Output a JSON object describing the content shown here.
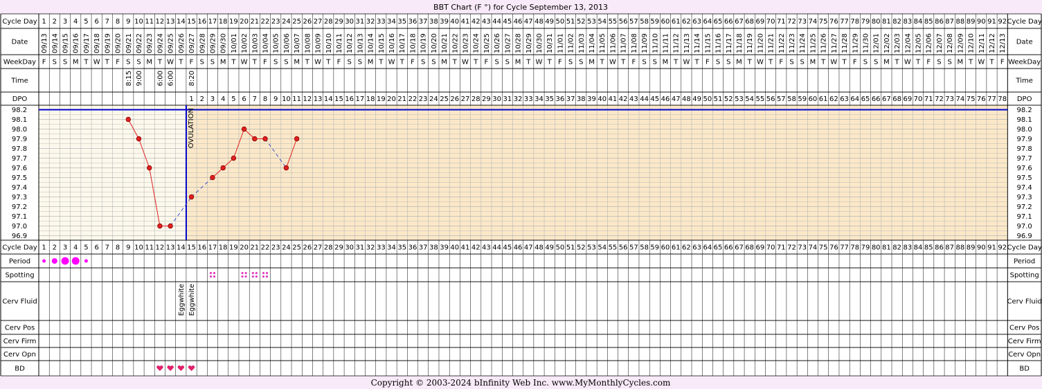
{
  "title": "BBT Chart (F °) for Cycle September 13, 2013",
  "copyright": "Copyright © 2003-2024 bInfinity Web Inc.     www.MyMonthlyCycles.com",
  "row_labels": {
    "cycle_day": "Cycle Day",
    "date": "Date",
    "weekday": "WeekDay",
    "time": "Time",
    "dpo": "DPO",
    "period": "Period",
    "spotting": "Spotting",
    "cerv_fluid": "Cerv Fluid",
    "cerv_pos": "Cerv Pos",
    "cerv_firm": "Cerv Firm",
    "cerv_opn": "Cerv Opn",
    "bd": "BD"
  },
  "ovulation_label": "OVULATION",
  "ovulation_day": 14,
  "num_days": 92,
  "start_date": "2013-09-13",
  "weekday_letters": [
    "F",
    "S",
    "S",
    "M",
    "T",
    "W",
    "T"
  ],
  "times": {
    "9": "8:15",
    "10": "9:00",
    "12": "6:00",
    "13": "6:00",
    "15": "8:20"
  },
  "period": {
    "1": "light",
    "2": "medium",
    "3": "heavy",
    "4": "heavy",
    "5": "light"
  },
  "spotting_days": [
    17,
    20,
    21,
    22
  ],
  "cerv_fluid": {
    "14": "Eggwhite",
    "15": "Eggwhite"
  },
  "bd_days": [
    12,
    13,
    14,
    15
  ],
  "colors": {
    "pre_fill": "#fcf9ec",
    "post_fill": "#fbe8c8",
    "grid": "#b7b7b7",
    "cover_line": "#0000cc",
    "ovulation_line": "#0000cc",
    "temp_line": "#e02020",
    "temp_dot": "#e02020",
    "dashed_line": "#3a4ccc",
    "period": "#ff00ff",
    "spotting": "#e040c0",
    "bd": "#e0206a",
    "page_bg": "#f8eaf8"
  },
  "chart_data": {
    "type": "line",
    "title": "BBT Chart (F °) for Cycle September 13, 2013",
    "xlabel": "Cycle Day",
    "ylabel": "",
    "ylim": [
      96.9,
      98.2
    ],
    "yticks": [
      "98.2",
      "98.1",
      "98.0",
      "97.9",
      "97.8",
      "97.7",
      "97.6",
      "97.5",
      "97.4",
      "97.3",
      "97.2",
      "97.1",
      "97.0",
      "96.9"
    ],
    "x_range": [
      1,
      92
    ],
    "series": [
      {
        "points": [
          {
            "x": 9,
            "y": 98.1
          },
          {
            "x": 10,
            "y": 97.9
          },
          {
            "x": 11,
            "y": 97.6
          },
          {
            "x": 12,
            "y": 97.0
          },
          {
            "x": 13,
            "y": 97.0
          },
          {
            "x": 15,
            "y": 97.3
          },
          {
            "x": 17,
            "y": 97.5
          },
          {
            "x": 18,
            "y": 97.6
          },
          {
            "x": 19,
            "y": 97.7
          },
          {
            "x": 20,
            "y": 98.0
          },
          {
            "x": 21,
            "y": 97.9
          },
          {
            "x": 22,
            "y": 97.9
          },
          {
            "x": 24,
            "y": 97.6
          },
          {
            "x": 25,
            "y": 97.9
          }
        ]
      }
    ],
    "cover_line": 98.2,
    "ovulation_day": 14,
    "dpo_start_day": 15,
    "dpo_values_start": 1,
    "grid": true
  }
}
